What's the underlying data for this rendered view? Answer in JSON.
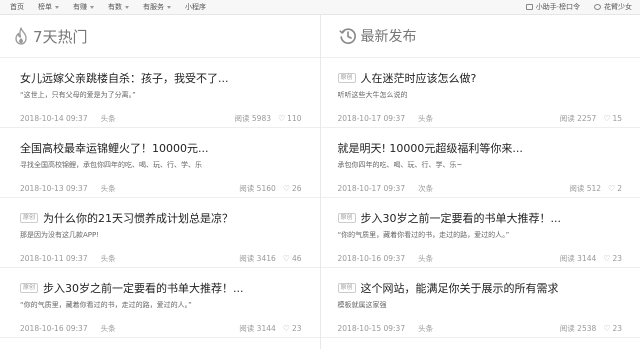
{
  "nav": {
    "items": [
      "首页",
      "榜单",
      "有赚",
      "有数",
      "有服务",
      "小程序"
    ],
    "right": {
      "assistant": "小助手·榜口令",
      "user": "花臂少女"
    }
  },
  "hot": {
    "title": "7天热门",
    "items": [
      {
        "title": "女儿远嫁父亲跳楼自杀：孩子，我受不了...",
        "summary": "“这世上，只有父母的爱是为了分离。”",
        "date": "2018-10-14 09:37",
        "source": "头条",
        "reads": "阅读 5983",
        "likes": "110",
        "tag": ""
      },
      {
        "title": "全国高校最幸运锦鲤火了！10000元...",
        "summary": "寻找全国高校锦鲤，承包你四年的吃、喝、玩、行、学、乐",
        "date": "2018-10-13 09:37",
        "source": "头条",
        "reads": "阅读 5160",
        "likes": "26",
        "tag": ""
      },
      {
        "title": "为什么你的21天习惯养成计划总是凉？",
        "summary": "那是因为没有这几款APP!",
        "date": "2018-10-11 09:37",
        "source": "头条",
        "reads": "阅读 3416",
        "likes": "46",
        "tag": "原创"
      },
      {
        "title": "步入30岁之前一定要看的书单大推荐！...",
        "summary": "“你的气质里，藏着你看过的书，走过的路，爱过的人。”",
        "date": "2018-10-16 09:37",
        "source": "头条",
        "reads": "阅读 3144",
        "likes": "23",
        "tag": "原创"
      }
    ]
  },
  "latest": {
    "title": "最新发布",
    "items": [
      {
        "title": "人在迷茫时应该怎么做?",
        "summary": "听听这些大牛怎么说的",
        "date": "2018-10-17 09:37",
        "source": "头条",
        "reads": "阅读 2257",
        "likes": "15",
        "tag": "原创"
      },
      {
        "title": "就是明天! 10000元超级福利等你来...",
        "summary": "承包你四年的吃、喝、玩、行、学、乐~",
        "date": "2018-10-17 09:37",
        "source": "次条",
        "reads": "阅读 512",
        "likes": "2",
        "tag": ""
      },
      {
        "title": "步入30岁之前一定要看的书单大推荐！...",
        "summary": "“你的气质里，藏着你看过的书，走过的路，爱过的人。”",
        "date": "2018-10-16 09:37",
        "source": "头条",
        "reads": "阅读 3144",
        "likes": "23",
        "tag": "原创"
      },
      {
        "title": "这个网站，能满足你关于展示的所有需求",
        "summary": "模板就属这家强",
        "date": "2018-10-15 09:37",
        "source": "头条",
        "reads": "阅读 2538",
        "likes": "23",
        "tag": "原创"
      }
    ]
  }
}
